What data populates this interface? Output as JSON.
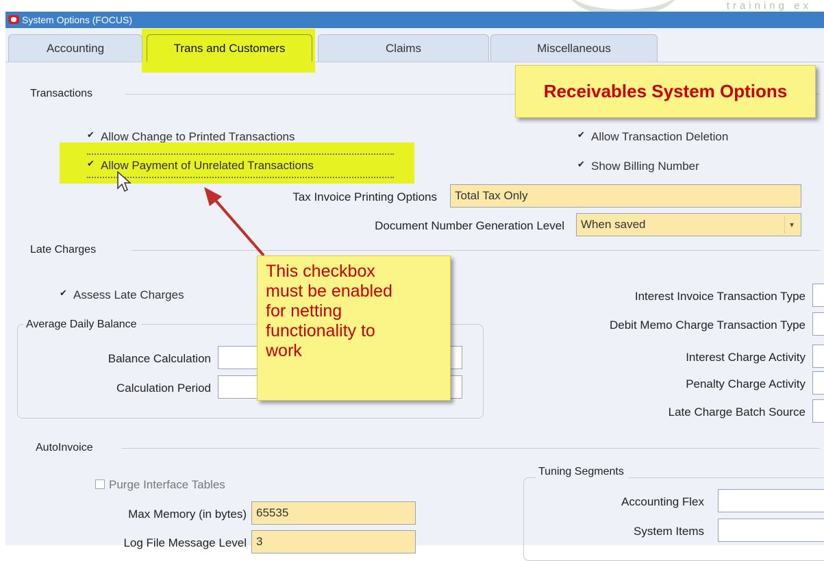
{
  "window": {
    "title": "System Options (FOCUS)"
  },
  "watermark": "training ex",
  "tabs": [
    {
      "label": "Accounting",
      "active": false
    },
    {
      "label": "Trans and Customers",
      "active": true
    },
    {
      "label": "Claims",
      "active": false
    },
    {
      "label": "Miscellaneous",
      "active": false
    }
  ],
  "transactions": {
    "section_title": "Transactions",
    "allow_change": {
      "label": "Allow Change to Printed Transactions",
      "checked": true
    },
    "allow_payment": {
      "label": "Allow Payment of Unrelated Transactions",
      "checked": true
    },
    "allow_deletion": {
      "label": "Allow Transaction Deletion",
      "checked": true
    },
    "show_billing": {
      "label": "Show Billing Number",
      "checked": true
    },
    "tax_invoice": {
      "label": "Tax Invoice Printing Options",
      "value": "Total Tax Only"
    },
    "doc_number": {
      "label": "Document Number Generation Level",
      "value": "When saved"
    }
  },
  "late_charges": {
    "section_title": "Late Charges",
    "assess": {
      "label": "Assess Late Charges",
      "checked": true
    },
    "adb_title": "Average Daily Balance",
    "balance_calc_label": "Balance Calculation",
    "calc_period_label": "Calculation Period",
    "interest_invoice_label": "Interest Invoice Transaction Type",
    "debit_memo_label": "Debit Memo Charge Transaction Type",
    "interest_activity_label": "Interest Charge Activity",
    "penalty_activity_label": "Penalty Charge Activity",
    "batch_source_label": "Late Charge Batch Source"
  },
  "autoinvoice": {
    "section_title": "AutoInvoice",
    "purge": {
      "label": "Purge Interface Tables",
      "checked": false
    },
    "max_memory_label": "Max Memory (in bytes)",
    "max_memory_value": "65535",
    "log_level_label": "Log File Message Level",
    "log_level_value": "3",
    "tuning_title": "Tuning Segments",
    "accounting_flex_label": "Accounting Flex",
    "system_items_label": "System Items"
  },
  "callouts": {
    "title": "Receivables System Options",
    "note_lines": [
      "This checkbox",
      "must be enabled",
      "for netting",
      "functionality to",
      "work"
    ]
  },
  "colors": {
    "titlebar": "#3d7fc6",
    "highlight": "#e6f222",
    "required_field": "#fce9a9",
    "callout_bg": "#fbf587",
    "callout_text": "#cc0000",
    "arrow": "#c0302a"
  }
}
